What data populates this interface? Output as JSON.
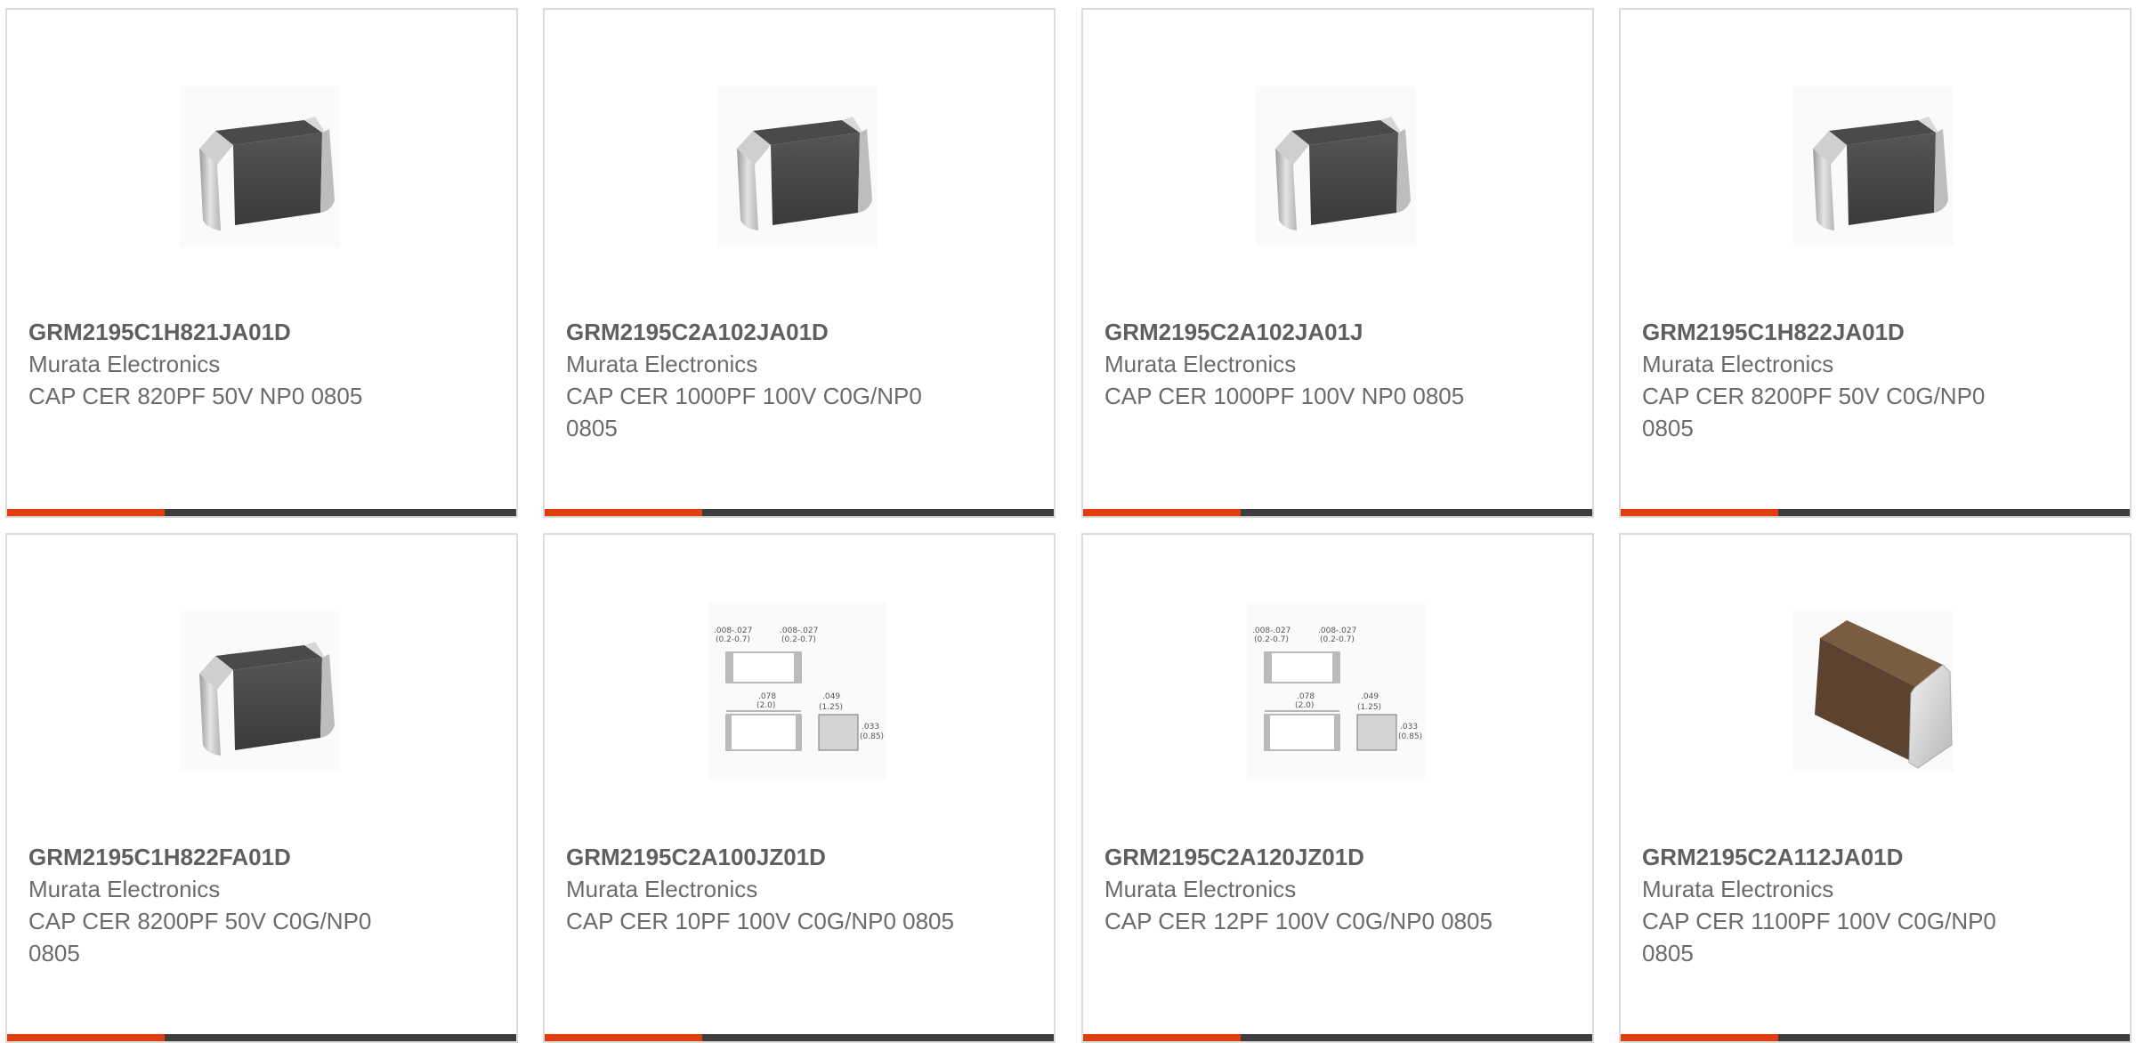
{
  "products": [
    {
      "part_number": "GRM2195C1H821JA01D",
      "manufacturer": "Murata Electronics",
      "description": "CAP CER 820PF 50V NP0 0805",
      "image_icon": "mlcc-chip-gray-icon"
    },
    {
      "part_number": "GRM2195C2A102JA01D",
      "manufacturer": "Murata Electronics",
      "description": "CAP CER 1000PF 100V C0G/NP0 0805",
      "image_icon": "mlcc-chip-gray-icon"
    },
    {
      "part_number": "GRM2195C2A102JA01J",
      "manufacturer": "Murata Electronics",
      "description": "CAP CER 1000PF 100V NP0 0805",
      "image_icon": "mlcc-chip-gray-icon"
    },
    {
      "part_number": "GRM2195C1H822JA01D",
      "manufacturer": "Murata Electronics",
      "description": "CAP CER 8200PF 50V C0G/NP0 0805",
      "image_icon": "mlcc-chip-gray-icon"
    },
    {
      "part_number": "GRM2195C1H822FA01D",
      "manufacturer": "Murata Electronics",
      "description": "CAP CER 8200PF 50V C0G/NP0 0805",
      "image_icon": "mlcc-chip-gray-icon"
    },
    {
      "part_number": "GRM2195C2A100JZ01D",
      "manufacturer": "Murata Electronics",
      "description": "CAP CER 10PF 100V C0G/NP0 0805",
      "image_icon": "dimension-drawing-icon"
    },
    {
      "part_number": "GRM2195C2A120JZ01D",
      "manufacturer": "Murata Electronics",
      "description": "CAP CER 12PF 100V C0G/NP0 0805",
      "image_icon": "dimension-drawing-icon"
    },
    {
      "part_number": "GRM2195C2A112JA01D",
      "manufacturer": "Murata Electronics",
      "description": "CAP CER 1100PF 100V C0G/NP0 0805",
      "image_icon": "mlcc-chip-brown-icon"
    }
  ],
  "drawing_labels": {
    "dim_a": ".008-.027",
    "dim_a_mm": "(0.2-0.7)",
    "dim_b": ".008-.027",
    "dim_b_mm": "(0.2-0.7)",
    "length": ".078",
    "length_mm": "(2.0)",
    "width": ".049",
    "width_mm": "(1.25)",
    "height": ".033",
    "height_mm": "(0.85)"
  },
  "colors": {
    "accent": "#e03e0f",
    "bar": "#3d3d3d",
    "card_border": "#dcdcdc",
    "text": "#6b6b6b"
  },
  "accent_fill_fraction": 0.31
}
